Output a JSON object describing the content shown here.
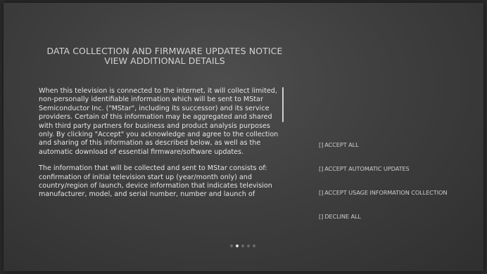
{
  "notice": {
    "title_line1": "DATA COLLECTION AND FIRMWARE UPDATES NOTICE",
    "title_line2": "VIEW ADDITIONAL DETAILS",
    "paragraph1": "When this television is connected to the internet, it will collect limited, non-personally identifiable information which will be sent to MStar Semiconductor Inc. (\"MStar\", including its successor) and its service providers. Certain of this information may be aggregated and shared with third party partners for business and product analysis purposes only. By clicking \"Accept\" you acknowledge and agree to the collection and sharing of this information as described below, as well as the automatic download of essential firmware/software updates.",
    "paragraph2": "The information that will be collected and sent to MStar consists of: confirmation of initial television start up (year/month only) and country/region of launch, device information that indicates television manufacturer, model, and serial number, number and launch of"
  },
  "options": [
    {
      "checkbox": "[]",
      "label": "ACCEPT ALL"
    },
    {
      "checkbox": "[]",
      "label": "ACCEPT AUTOMATIC UPDATES"
    },
    {
      "checkbox": "[]",
      "label": "ACCEPT USAGE INFORMATION COLLECTION"
    },
    {
      "checkbox": "[]",
      "label": "DECLINE ALL"
    }
  ],
  "pagination": {
    "total_pages": 5,
    "current_page": 2
  },
  "colors": {
    "text": "#e6e6e6",
    "option_text": "#cdcdcd",
    "active_dot": "#e0e0e0",
    "inactive_dot": "#6a6a6a"
  }
}
